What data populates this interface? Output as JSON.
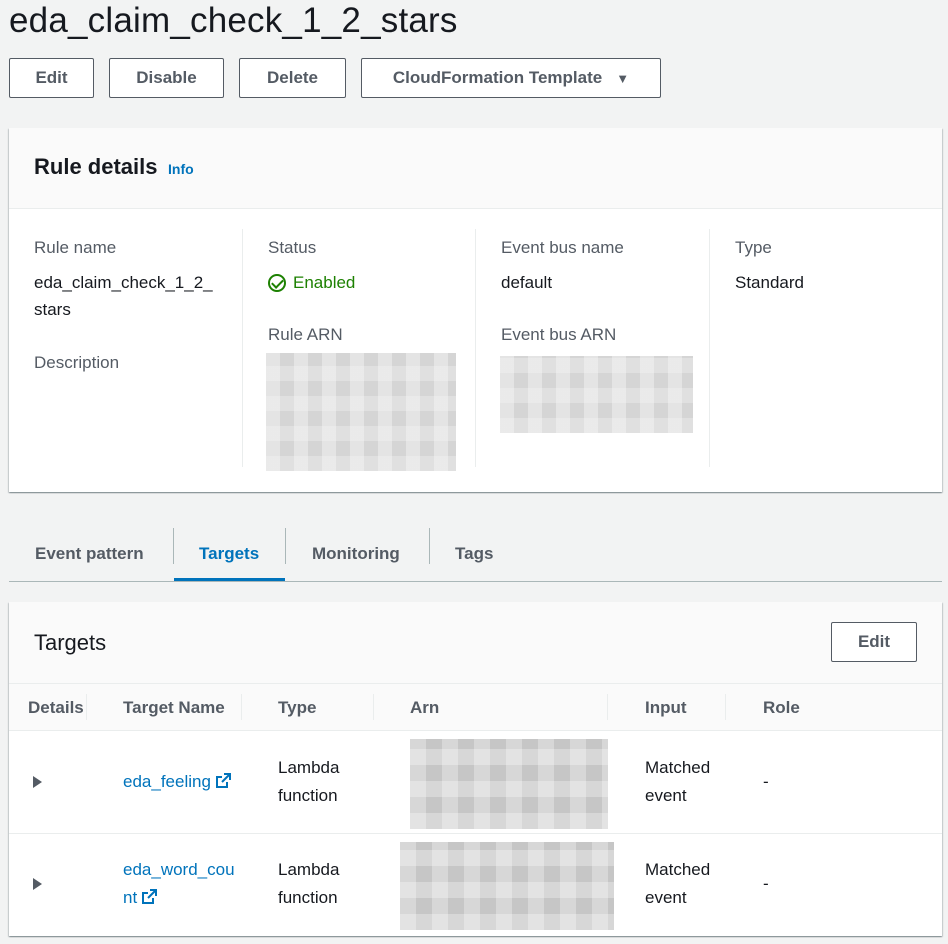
{
  "page": {
    "title": "eda_claim_check_1_2_stars"
  },
  "actions": {
    "edit": "Edit",
    "disable": "Disable",
    "delete": "Delete",
    "cloudformation": "CloudFormation Template"
  },
  "rule_details": {
    "heading": "Rule details",
    "info": "Info",
    "rule_name_label": "Rule name",
    "rule_name_line1": "eda_claim_check_1_2_",
    "rule_name_line2": "stars",
    "description_label": "Description",
    "status_label": "Status",
    "status_value": "Enabled",
    "rule_arn_label": "Rule ARN",
    "event_bus_name_label": "Event bus name",
    "event_bus_name_value": "default",
    "event_bus_arn_label": "Event bus ARN",
    "type_label": "Type",
    "type_value": "Standard"
  },
  "tabs": [
    {
      "label": "Event pattern",
      "active": false
    },
    {
      "label": "Targets",
      "active": true
    },
    {
      "label": "Monitoring",
      "active": false
    },
    {
      "label": "Tags",
      "active": false
    }
  ],
  "targets": {
    "heading": "Targets",
    "edit": "Edit",
    "columns": [
      "Details",
      "Target Name",
      "Type",
      "Arn",
      "Input",
      "Role"
    ],
    "rows": [
      {
        "name": "eda_feeling",
        "name_line2": "",
        "type_line1": "Lambda",
        "type_line2": "function",
        "input_line1": "Matched",
        "input_line2": "event",
        "role": "-"
      },
      {
        "name": "eda_word_cou",
        "name_line2": "nt",
        "type_line1": "Lambda",
        "type_line2": "function",
        "input_line1": "Matched",
        "input_line2": "event",
        "role": "-"
      }
    ]
  },
  "colors": {
    "accent": "#0073bb",
    "success": "#1d8102",
    "background": "#f2f3f3"
  }
}
